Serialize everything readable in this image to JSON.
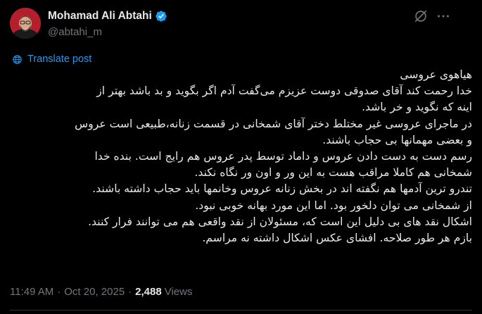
{
  "author": {
    "display_name": "Mohamad Ali Abtahi",
    "handle": "@abtahi_m",
    "verified": true,
    "verified_color": "#1d9bf0"
  },
  "actions": {
    "grok_icon": "grok-icon",
    "more_icon": "more-icon"
  },
  "translate_label": "Translate post",
  "body_lines": [
    "هیاهوی عروسی",
    "خدا رحمت کند آقای صدوقی دوست عزیزم  می‌گفت آدم اگر بگوید و بد باشد بهتر از",
    "اینه که نگوید و خر باشد.",
    "در ماجرای عروسی غیر مختلط دختر آقای شمخانی در قسمت زنانه،طبیعی است عروس",
    "و بعضی مهمانها بی حجاب باشند.",
    "رسم دست به دست دادن عروس و داماد توسط پدر عروس هم رایج است. بنده خدا",
    "شمخانی هم کاملا مراقب هست به این ور و اون ور نگاه نکند.",
    "تندرو ترین آدمها هم نگفته اند در بخش زنانه عروس وخانمها باید حجاب داشته باشند.",
    "از شمخانی می توان دلخور بود. اما این مورد بهانه خوبی نبود.",
    "اشکال نقد های بی دلیل این است که، مسئولان از نقد واقعی هم می توانند فرار کنند.",
    "بازم هر طور صلاحه. افشای عکس اشکال داشته نه مراسم."
  ],
  "meta": {
    "time": "11:49 AM",
    "separator": "·",
    "date": "Oct 20, 2025",
    "views_count": "2,488",
    "views_label": "Views"
  },
  "colors": {
    "background": "#000000",
    "text": "#e7e9ea",
    "muted": "#71767b",
    "accent": "#1d9bf0"
  }
}
